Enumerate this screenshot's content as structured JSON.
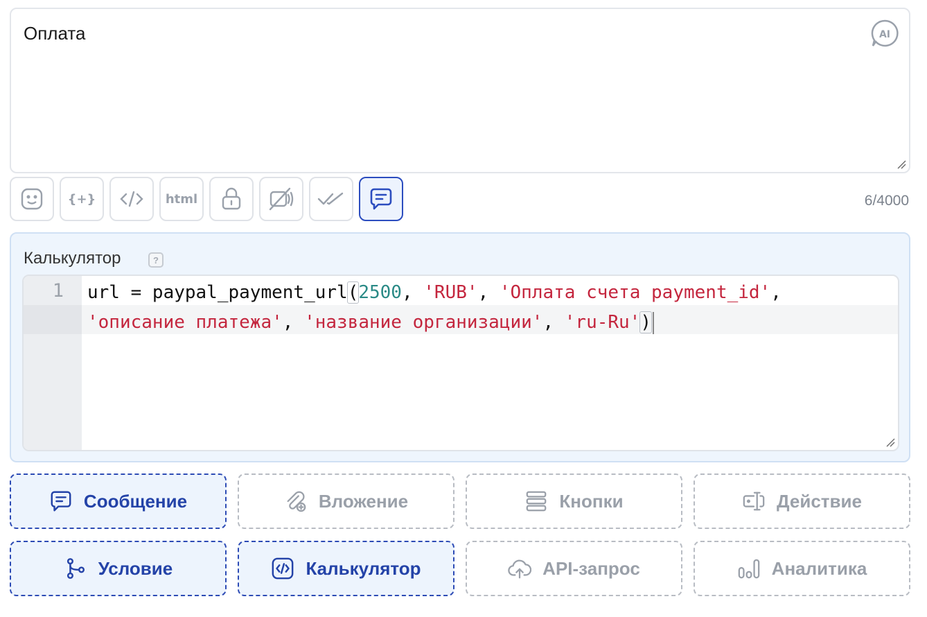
{
  "message": {
    "text": "Оплата",
    "ai_badge": "AI",
    "counter": "6/4000"
  },
  "toolbar": {
    "tools": [
      {
        "icon": "emoji-icon",
        "label": ""
      },
      {
        "icon": "variable-icon",
        "label": "{+}"
      },
      {
        "icon": "code-icon",
        "label": ""
      },
      {
        "icon": "html-icon",
        "label": "html"
      },
      {
        "icon": "lock-icon",
        "label": ""
      },
      {
        "icon": "mute-icon",
        "label": ""
      },
      {
        "icon": "double-check-icon",
        "label": ""
      },
      {
        "icon": "chat-icon",
        "label": "",
        "active": true
      }
    ]
  },
  "calculator": {
    "title": "Калькулятор",
    "help": "?",
    "line_number": "1",
    "code": {
      "l1_a": "url = paypal_payment_url",
      "l1_paren": "(",
      "l1_num": "2500",
      "l1_sep1": ", ",
      "l1_s1": "'RUB'",
      "l1_sep2": ", ",
      "l1_s2": "'Оплата счета payment_id'",
      "l1_sep3": ",",
      "l2_s1": "'описание платежа'",
      "l2_sep1": ", ",
      "l2_s2": "'название организации'",
      "l2_sep2": ", ",
      "l2_s3": "'ru-Ru'",
      "l2_paren": ")"
    }
  },
  "blocks": {
    "message": "Сообщение",
    "attachment": "Вложение",
    "buttons": "Кнопки",
    "action": "Действие",
    "condition": "Условие",
    "calculator": "Калькулятор",
    "api": "API-запрос",
    "analytics": "Аналитика"
  },
  "colors": {
    "accent": "#2c4dbf",
    "accent_bg": "#edf4fd",
    "string": "#c4263e",
    "number": "#2a8a86"
  }
}
